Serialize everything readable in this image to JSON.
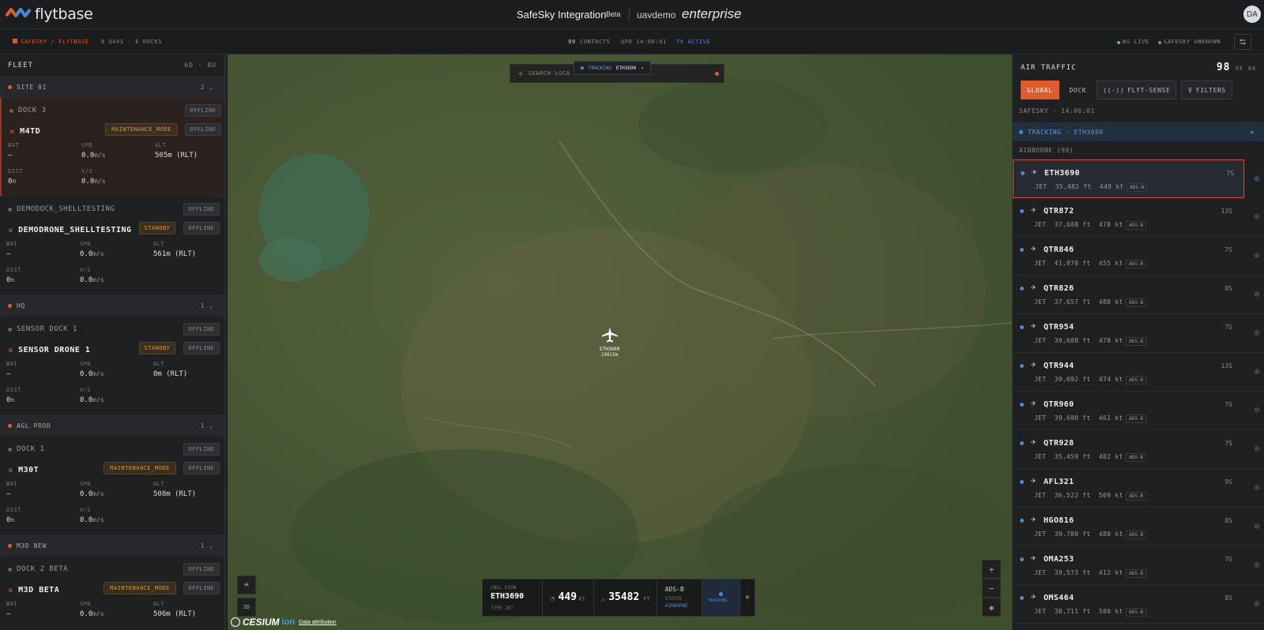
{
  "header": {
    "logo_text": "flytbase",
    "app_name": "SafeSky Integration",
    "beta": "Beta",
    "org": "uavdemo",
    "plan": "enterprise",
    "avatar": "DA"
  },
  "statusbar": {
    "source": "SAFESKY / FLYTBASE",
    "counts": "8 UAVS · 6 DOCKS",
    "contacts_n": "99",
    "contacts": "CONTACTS",
    "upd": "UPD 14:06:01",
    "tx": "TX ACTIVE",
    "ws": "WS LIVE",
    "safesky": "SAFESKY UNKNOWN"
  },
  "fleet": {
    "title": "FLEET",
    "summary": "6D · 8U",
    "sites": [
      {
        "name": "SITE 01",
        "count": "2"
      },
      {
        "name": "HQ",
        "count": "1"
      },
      {
        "name": "AGL PROD",
        "count": "1"
      },
      {
        "name": "M3D NEW",
        "count": "1"
      }
    ],
    "docks": [
      {
        "dock": "DOCK 3",
        "dock_status": "OFFLINE",
        "drone": "M4TD",
        "mode": "MAINTENANCE_MODE",
        "drone_status": "OFFLINE",
        "bat": "—",
        "spd": "0.0",
        "alt": "505m (RLT)",
        "dist": "0",
        "vs": "0.0"
      },
      {
        "dock": "DEMODOCK_SHELLTESTING",
        "dock_status": "OFFLINE",
        "drone": "DEMODRONE_SHELLTESTING",
        "mode": "STANDBY",
        "drone_status": "OFFLINE",
        "bat": "—",
        "spd": "0.0",
        "alt": "561m (RLT)",
        "dist": "0",
        "vs": "0.0"
      },
      {
        "dock": "SENSOR DOCK 1",
        "dock_status": "OFFLINE",
        "drone": "SENSOR DRONE 1",
        "mode": "STANDBY",
        "drone_status": "OFFLINE",
        "bat": "—",
        "spd": "0.0",
        "alt": "0m (RLT)",
        "dist": "0",
        "vs": "0.0"
      },
      {
        "dock": "DOCK 1",
        "dock_status": "OFFLINE",
        "drone": "M30T",
        "mode": "MAINTENANCE_MODE",
        "drone_status": "OFFLINE",
        "bat": "—",
        "spd": "0.0",
        "alt": "508m (RLT)",
        "dist": "0",
        "vs": "0.0"
      },
      {
        "dock": "DOCK 2 BETA",
        "dock_status": "OFFLINE",
        "drone": "M3D BETA",
        "mode": "MAINTENANCE_MODE",
        "drone_status": "OFFLINE",
        "bat": "—",
        "spd": "0.0",
        "alt": "506m (RLT)"
      }
    ],
    "labels": {
      "bat": "BAT",
      "spd": "SPD",
      "alt": "ALT",
      "dist": "DIST",
      "vs": "V/S",
      "ms": "m/s",
      "m": "m"
    }
  },
  "map": {
    "search_placeholder": "SEARCH LOCA",
    "tracking_label": "TRACKING",
    "tracking_id": "ETH3690",
    "plane_label": "ETH3690",
    "plane_sub": "10815m",
    "hud": {
      "callsign_lbl": "CALL SIGN",
      "callsign": "ETH3690",
      "type": "TYPE JET",
      "speed": "449",
      "speed_unit": "KT",
      "alt": "35482",
      "alt_unit": "FT",
      "src": "ADS-B",
      "status_lbl": "STATUS",
      "status": "AIRBORNE",
      "tracking": "TRACKING"
    },
    "mode_2d": "2D",
    "cesium": "CESIUM",
    "ion": "ion",
    "attribution": "Data attribution"
  },
  "traffic": {
    "title": "AIR TRAFFIC",
    "count": "98",
    "of": "OF 99",
    "tabs": [
      "GLOBAL",
      "DOCK",
      "FLYT-SENSE",
      "FILTERS"
    ],
    "safesky": "SAFESKY · 14:06:01",
    "tracking": "TRACKING · ETH3690",
    "airborne": "AIRBORNE (90)",
    "aircraft": [
      {
        "cs": "ETH3690",
        "age": "7S",
        "det": "JET  35,482 ft  449 kt",
        "src": "ADS-B"
      },
      {
        "cs": "QTR872",
        "age": "13S",
        "det": "JET  37,608 ft  478 kt",
        "src": "ADS-B"
      },
      {
        "cs": "QTR846",
        "age": "7S",
        "det": "JET  41,870 ft  455 kt",
        "src": "ADS-B"
      },
      {
        "cs": "QTR826",
        "age": "8S",
        "det": "JET  37,657 ft  488 kt",
        "src": "ADS-B"
      },
      {
        "cs": "QTR954",
        "age": "7S",
        "det": "JET  39,688 ft  478 kt",
        "src": "ADS-B"
      },
      {
        "cs": "QTR944",
        "age": "13S",
        "det": "JET  39,692 ft  474 kt",
        "src": "ADS-B"
      },
      {
        "cs": "QTR960",
        "age": "7S",
        "det": "JET  39,600 ft  461 kt",
        "src": "ADS-B"
      },
      {
        "cs": "QTR928",
        "age": "7S",
        "det": "JET  35,459 ft  482 kt",
        "src": "ADS-B"
      },
      {
        "cs": "AFL321",
        "age": "9S",
        "det": "JET  36,522 ft  509 kt",
        "src": "ADS-B"
      },
      {
        "cs": "HGO816",
        "age": "8S",
        "det": "JET  39,780 ft  480 kt",
        "src": "ADS-B"
      },
      {
        "cs": "OMA253",
        "age": "7S",
        "det": "JET  39,573 ft  412 kt",
        "src": "ADS-B"
      },
      {
        "cs": "OMS464",
        "age": "8S",
        "det": "JET  38,711 ft  500 kt",
        "src": "ADS-B"
      }
    ]
  },
  "colors": {
    "accent": "#e05a2b",
    "track_blue": "#4a8ad4",
    "warn": "#d49a4a"
  }
}
